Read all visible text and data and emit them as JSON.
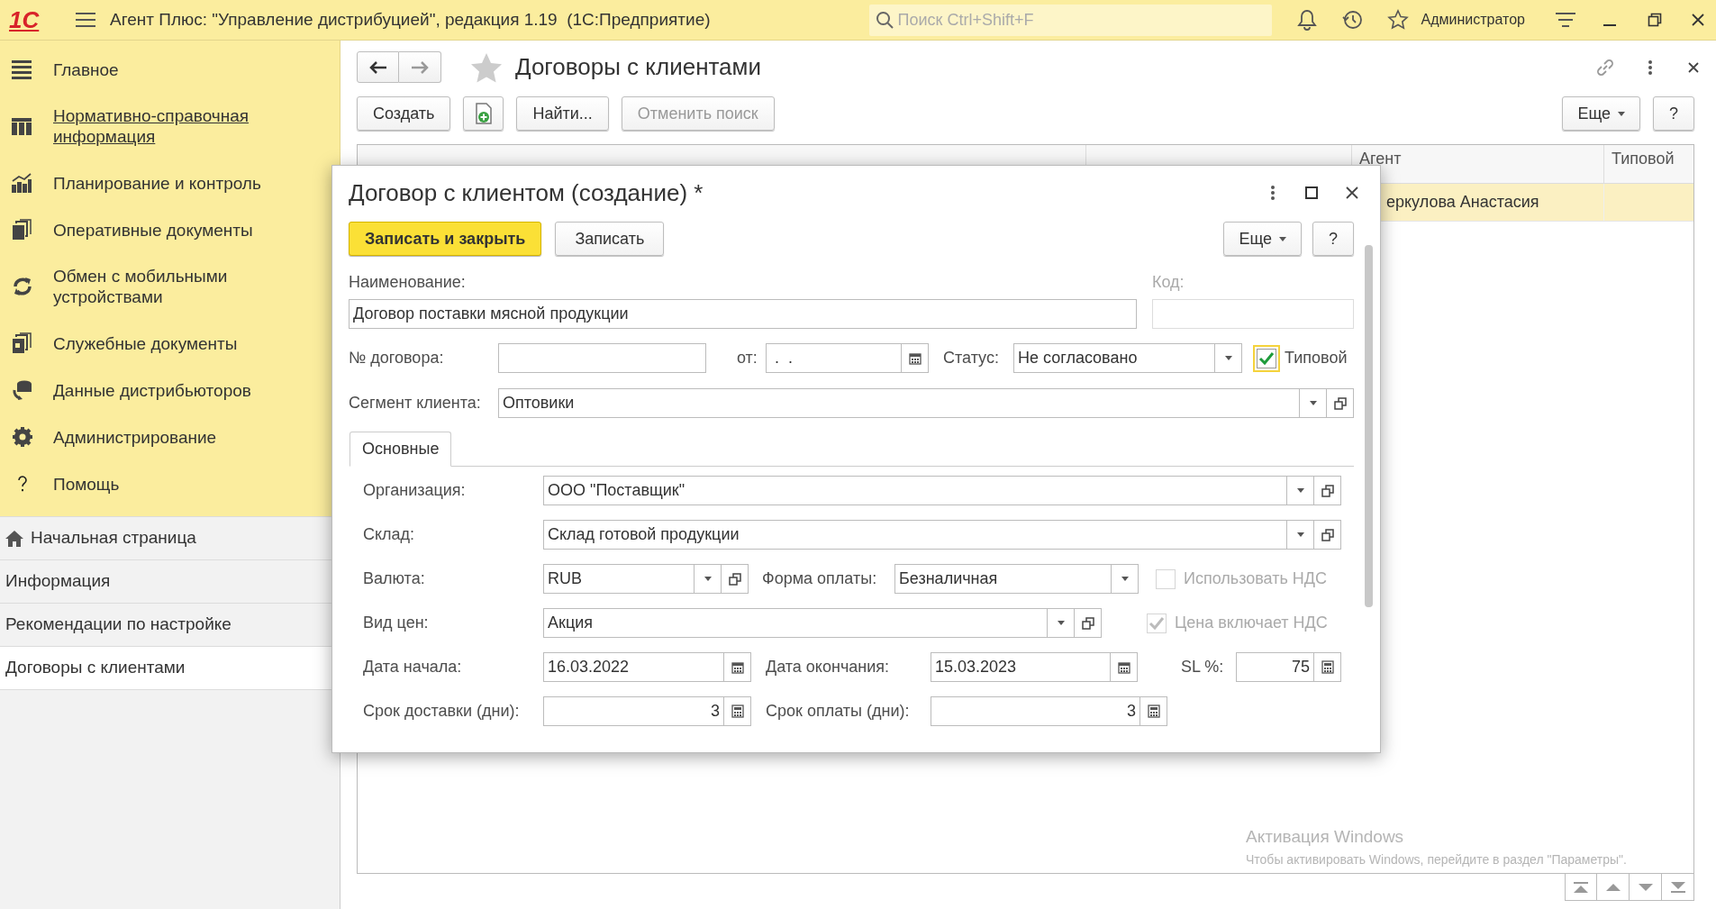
{
  "app": {
    "logo": "1С",
    "title": "Агент Плюс: \"Управление дистрибуцией\", редакция 1.19  (1С:Предприятие)",
    "search": {
      "placeholder": "Поиск Ctrl+Shift+F"
    },
    "user": "Администратор"
  },
  "sidebar": {
    "sections": [
      {
        "label": "Главное",
        "underlined": false
      },
      {
        "label": "Нормативно-справочная информация",
        "underlined": true
      },
      {
        "label": "Планирование и контроль",
        "underlined": false
      },
      {
        "label": "Оперативные документы",
        "underlined": false
      },
      {
        "label": "Обмен с мобильными устройствами",
        "underlined": false
      },
      {
        "label": "Служебные документы",
        "underlined": false
      },
      {
        "label": "Данные дистрибьюторов",
        "underlined": false
      },
      {
        "label": "Администрирование",
        "underlined": false
      },
      {
        "label": "Помощь",
        "underlined": false
      }
    ],
    "open_windows": [
      {
        "label": "Начальная страница",
        "selected": false
      },
      {
        "label": "Информация",
        "selected": false
      },
      {
        "label": "Рекомендации по настройке",
        "selected": false
      },
      {
        "label": "Договоры с клиентами",
        "selected": true
      }
    ]
  },
  "list": {
    "title": "Договоры с клиентами",
    "toolbar": [
      {
        "label": "Создать",
        "kind": "button",
        "disabled": false
      },
      {
        "kind": "add-copy",
        "disabled": false
      },
      {
        "label": "Найти...",
        "kind": "button",
        "disabled": false
      },
      {
        "label": "Отменить поиск",
        "kind": "button",
        "disabled": true
      }
    ],
    "more": "Еще",
    "help": "?",
    "columns": [
      {
        "label": "Агент"
      },
      {
        "label": "Типовой"
      }
    ],
    "rows": [
      {
        "agent": "еркулова Анастасия",
        "selected": true
      }
    ]
  },
  "dialog": {
    "title": "Договор с клиентом (создание) *",
    "buttons": [
      {
        "label": "Записать и закрыть",
        "kind": "primary"
      },
      {
        "label": "Записать",
        "kind": "normal"
      }
    ],
    "more": "Еще",
    "help": "?",
    "name": {
      "label": "Наименование:",
      "value": "Договор поставки мясной продукции"
    },
    "code": {
      "label": "Код:"
    },
    "number": {
      "label": "№ договора:"
    },
    "date": {
      "label": "от:",
      "value": " .  ."
    },
    "status": {
      "label": "Статус:",
      "value": "Не согласовано"
    },
    "typical": {
      "label": "Типовой",
      "checked": true,
      "disabled": false
    },
    "segment": {
      "label": "Сегмент клиента:",
      "value": "Оптовики"
    },
    "tabs": [
      {
        "label": "Основные",
        "selected": true
      }
    ],
    "organization": {
      "label": "Организация:",
      "value": "ООО \"Поставщик\""
    },
    "warehouse": {
      "label": "Склад:",
      "value": "Склад готовой продукции"
    },
    "currency": {
      "label": "Валюта:",
      "value": "RUB"
    },
    "payment_form": {
      "label": "Форма оплаты:",
      "value": "Безналичная"
    },
    "use_vat": {
      "label": "Использовать НДС",
      "checked": false,
      "disabled": true
    },
    "price_type": {
      "label": "Вид цен:",
      "value": "Акция"
    },
    "price_includes_vat": {
      "label": "Цена включает НДС",
      "checked": true,
      "disabled": true
    },
    "start_date": {
      "label": "Дата начала:",
      "value": "16.03.2022"
    },
    "end_date": {
      "label": "Дата окончания:",
      "value": "15.03.2023"
    },
    "sl": {
      "label": "SL %:",
      "value": "75"
    },
    "delivery_days": {
      "label": "Срок доставки (дни):",
      "value": "3"
    },
    "payment_days": {
      "label": "Срок оплаты (дни):",
      "value": "3"
    }
  },
  "os_notice": {
    "title": "Активация Windows",
    "text": "Чтобы активировать Windows, перейдите в раздел \"Параметры\"."
  }
}
